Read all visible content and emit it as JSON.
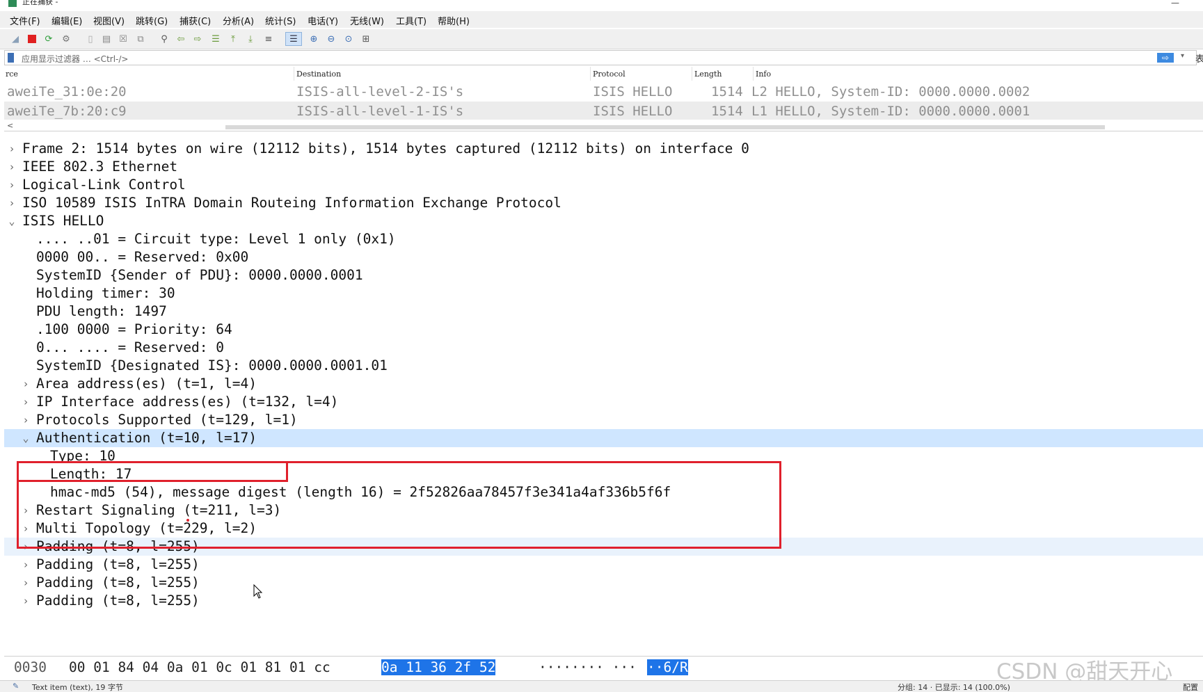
{
  "window": {
    "title": "正在捕获 -",
    "min_glyph": "—"
  },
  "menu": [
    "文件(F)",
    "编辑(E)",
    "视图(V)",
    "跳转(G)",
    "捕获(C)",
    "分析(A)",
    "统计(S)",
    "电话(Y)",
    "无线(W)",
    "工具(T)",
    "帮助(H)"
  ],
  "toolbar_icons": [
    "shark-fin-start-icon",
    "stop-capture-icon",
    "restart-capture-icon",
    "capture-options-icon",
    "open-file-icon",
    "save-file-icon",
    "close-file-icon",
    "reload-file-icon",
    "find-packet-icon",
    "go-back-icon",
    "go-forward-icon",
    "go-to-packet-icon",
    "go-first-icon",
    "go-last-icon",
    "auto-scroll-icon",
    "colorize-icon",
    "zoom-in-icon",
    "zoom-out-icon",
    "normal-size-icon",
    "resize-columns-icon"
  ],
  "filter": {
    "placeholder": "应用显示过滤器 … <Ctrl-/>",
    "apply_glyph": "⇨",
    "dropdown_glyph": "▾"
  },
  "right_edge_text": "表",
  "packet_list": {
    "columns": [
      "rce",
      "Destination",
      "Protocol",
      "Length",
      "Info"
    ],
    "rows": [
      {
        "source": "aweiTe_31:0e:20",
        "destination": "ISIS-all-level-2-IS's",
        "protocol": "ISIS HELLO",
        "length": "1514",
        "info": "L2 HELLO, System-ID: 0000.0000.0002"
      },
      {
        "source": "aweiTe_7b:20:c9",
        "destination": "ISIS-all-level-1-IS's",
        "protocol": "ISIS HELLO",
        "length": "1514",
        "info": "L1 HELLO, System-ID: 0000.0000.0001"
      }
    ],
    "scroll_left_glyph": "<"
  },
  "tree": [
    {
      "text": "Frame 2: 1514 bytes on wire (12112 bits), 1514 bytes captured (12112 bits) on interface 0",
      "arrow": "›"
    },
    {
      "text": "IEEE 802.3 Ethernet",
      "arrow": "›"
    },
    {
      "text": "Logical-Link Control",
      "arrow": "›"
    },
    {
      "text": "ISO 10589 ISIS InTRA Domain Routeing Information Exchange Protocol",
      "arrow": "›"
    },
    {
      "text": "ISIS HELLO",
      "arrow": "⌄"
    },
    {
      "text": ".... ..01 = Circuit type: Level 1 only (0x1)",
      "arrow": ""
    },
    {
      "text": "0000 00.. = Reserved: 0x00",
      "arrow": ""
    },
    {
      "text": "SystemID {Sender of PDU}: 0000.0000.0001",
      "arrow": ""
    },
    {
      "text": "Holding timer: 30",
      "arrow": ""
    },
    {
      "text": "PDU length: 1497",
      "arrow": ""
    },
    {
      "text": ".100 0000 = Priority: 64",
      "arrow": ""
    },
    {
      "text": "0... .... = Reserved: 0",
      "arrow": ""
    },
    {
      "text": "SystemID {Designated IS}: 0000.0000.0001.01",
      "arrow": ""
    },
    {
      "text": "Area address(es) (t=1, l=4)",
      "arrow": "›"
    },
    {
      "text": "IP Interface address(es) (t=132, l=4)",
      "arrow": "›"
    },
    {
      "text": "Protocols Supported (t=129, l=1)",
      "arrow": "›"
    },
    {
      "text": "Authentication (t=10, l=17)",
      "arrow": "⌄"
    },
    {
      "text": "Type: 10",
      "arrow": ""
    },
    {
      "text": "Length: 17",
      "arrow": ""
    },
    {
      "text": "hmac-md5 (54), message digest (length 16) = 2f52826aa78457f3e341a4af336b5f6f",
      "arrow": ""
    },
    {
      "text": "Restart Signaling (t=211, l=3)",
      "arrow": "›"
    },
    {
      "text": "Multi Topology (t=229, l=2)",
      "arrow": "›"
    },
    {
      "text": "Padding (t=8, l=255)",
      "arrow": "›"
    },
    {
      "text": "Padding (t=8, l=255)",
      "arrow": "›"
    },
    {
      "text": "Padding (t=8, l=255)",
      "arrow": "›"
    },
    {
      "text": "Padding (t=8, l=255)",
      "arrow": "›"
    }
  ],
  "bytes": {
    "offset": "0030",
    "hex_plain": "00 01 84 04 0a 01 0c 01  81 01 cc",
    "hex_selected": "0a 11 36 2f 52",
    "ascii_plain": "········ ···",
    "ascii_selected": "··6/R"
  },
  "watermark": "CSDN @甜天开心",
  "status": {
    "left": "Text item (text), 19 字节",
    "right": "分组: 14 · 已显示: 14 (100.0%)",
    "profile": "配置"
  },
  "colors": {
    "selection": "#cfe6ff",
    "hover": "#e9f2fc",
    "annotation": "#e0202c",
    "byte_highlight": "#1e74e8"
  }
}
